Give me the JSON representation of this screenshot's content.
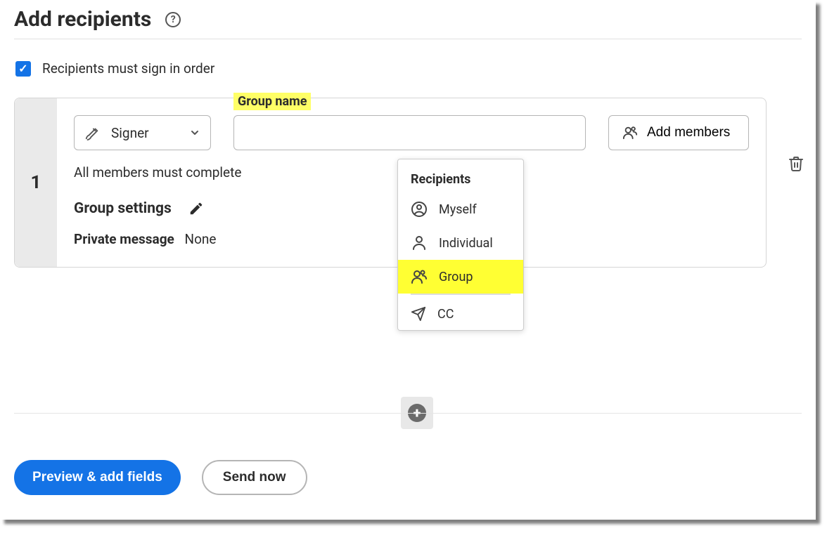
{
  "header": {
    "title": "Add recipients"
  },
  "order": {
    "label": "Recipients must sign in order",
    "checked": true
  },
  "recipient": {
    "index": "1",
    "role": "Signer",
    "group_field_label": "Group name",
    "group_name": "",
    "add_members_label": "Add members",
    "must_complete": "All members must complete",
    "group_settings_label": "Group settings",
    "private_message_label": "Private message",
    "private_message_value": "None"
  },
  "dropdown": {
    "header": "Recipients",
    "items": [
      {
        "label": "Myself",
        "icon": "user-circle-icon",
        "highlight": false
      },
      {
        "label": "Individual",
        "icon": "person-icon",
        "highlight": false
      },
      {
        "label": "Group",
        "icon": "group-icon",
        "highlight": true
      }
    ],
    "cc_label": "CC"
  },
  "footer": {
    "preview_label": "Preview & add fields",
    "send_label": "Send now"
  }
}
